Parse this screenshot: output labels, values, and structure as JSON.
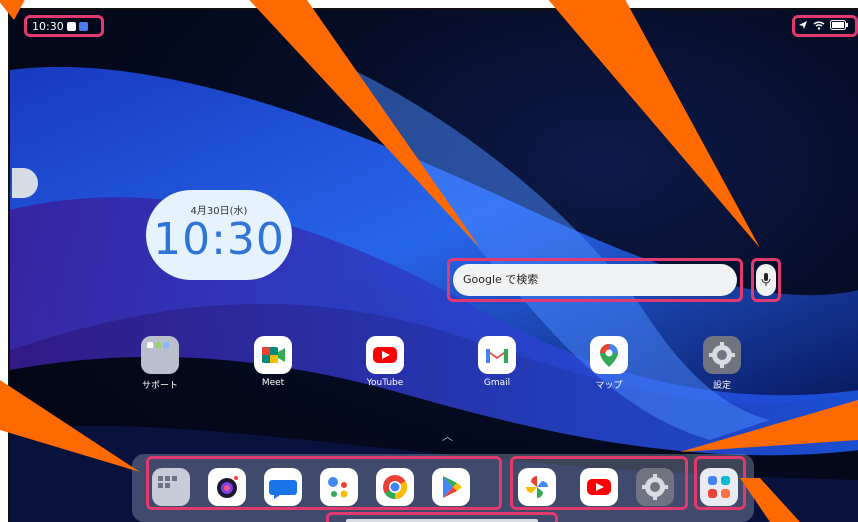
{
  "status_bar": {
    "time": "10:30"
  },
  "clock_widget": {
    "date": "4月30日(水)",
    "time": "10:30"
  },
  "search": {
    "placeholder": "Google で検索"
  },
  "home_apps": [
    {
      "label": "サポート",
      "icon": "folder-icon"
    },
    {
      "label": "Meet",
      "icon": "meet-icon"
    },
    {
      "label": "YouTube",
      "icon": "youtube-icon"
    },
    {
      "label": "Gmail",
      "icon": "gmail-icon"
    },
    {
      "label": "マップ",
      "icon": "maps-icon"
    },
    {
      "label": "設定",
      "icon": "settings-icon"
    }
  ],
  "dock": {
    "group1": [
      "folder-icon",
      "camera-icon",
      "messages-icon",
      "assistant-icon",
      "chrome-icon",
      "play-store-icon"
    ],
    "group2": [
      "photos-icon",
      "youtube-icon",
      "settings-icon"
    ],
    "group3": [
      "app-drawer-icon"
    ]
  },
  "colors": {
    "highlight": "#e23a6f",
    "callout": "#ff6a00"
  }
}
